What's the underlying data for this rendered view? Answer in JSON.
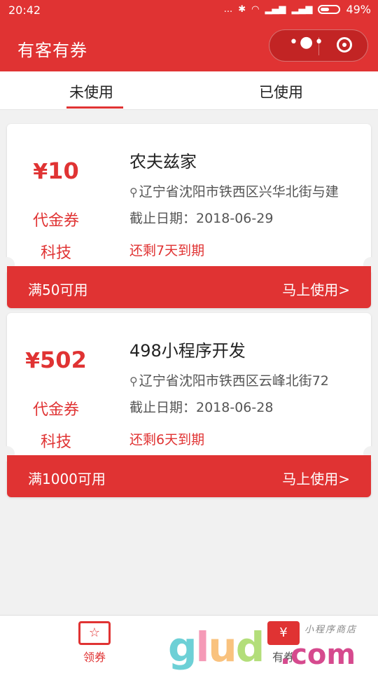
{
  "status_bar": {
    "time": "20:42",
    "signal_dots": "...",
    "battery_percent": "49%",
    "battery_level": 0.49
  },
  "nav": {
    "title": "有客有券",
    "more_glyph": "•●•"
  },
  "tabs": [
    {
      "label": "未使用",
      "active": true
    },
    {
      "label": "已使用",
      "active": false
    }
  ],
  "coupons": [
    {
      "currency": "¥",
      "amount": "10",
      "type": "代金券",
      "category": "科技",
      "merchant": "农夫兹家",
      "address": "辽宁省沈阳市铁西区兴华北街与建",
      "deadline": "截止日期：2018-06-29",
      "expire_note": "还剩7天到期",
      "condition": "满50可用",
      "use_label": "马上使用>"
    },
    {
      "currency": "¥",
      "amount": "502",
      "type": "代金券",
      "category": "科技",
      "merchant": "498小程序开发",
      "address": "辽宁省沈阳市铁西区云峰北街72",
      "deadline": "截止日期：2018-06-28",
      "expire_note": "还剩6天到期",
      "condition": "满1000可用",
      "use_label": "马上使用>"
    }
  ],
  "bottom_tabs": [
    {
      "label": "领券",
      "icon": "star-ticket-icon",
      "active": true
    },
    {
      "label": "有券",
      "icon": "yen-ticket-icon",
      "active": false
    }
  ],
  "watermark": {
    "g": "g",
    "l": "l",
    "u": "u",
    "d": "d",
    "com": ".com",
    "tagline": "小程序商店"
  },
  "colors": {
    "brand_red": "#e03333",
    "background": "#f1f1f1"
  }
}
